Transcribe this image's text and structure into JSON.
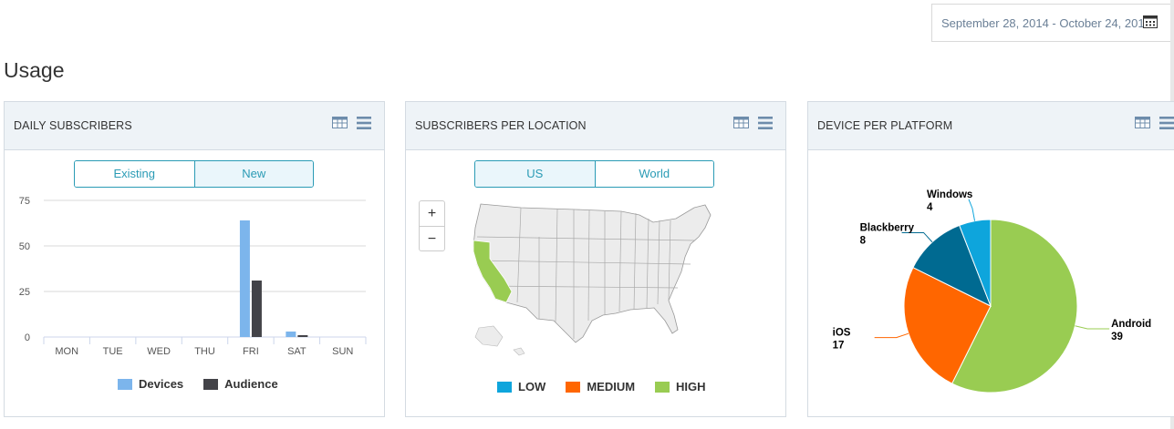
{
  "header": {
    "date_range": "September 28, 2014 - October 24, 2015",
    "calendar_icon": "calendar-icon",
    "page_title": "Usage"
  },
  "panels": {
    "daily": {
      "title": "DAILY SUBSCRIBERS",
      "tabs": [
        "Existing",
        "New"
      ],
      "active_tab": "New",
      "icons": [
        "table-icon",
        "menu-icon"
      ]
    },
    "location": {
      "title": "SUBSCRIBERS PER LOCATION",
      "tabs": [
        "US",
        "World"
      ],
      "active_tab": "US",
      "zoom_in": "+",
      "zoom_out": "−",
      "legend": [
        {
          "label": "LOW",
          "color": "#0ea5dc"
        },
        {
          "label": "MEDIUM",
          "color": "#ff6600"
        },
        {
          "label": "HIGH",
          "color": "#99cc52"
        }
      ],
      "highlighted_state": "California",
      "icons": [
        "table-icon",
        "menu-icon"
      ]
    },
    "platform": {
      "title": "DEVICE PER PLATFORM",
      "icons": [
        "table-icon",
        "menu-icon"
      ]
    }
  },
  "chart_data": [
    {
      "type": "bar",
      "categories": [
        "MON",
        "TUE",
        "WED",
        "THU",
        "FRI",
        "SAT",
        "SUN"
      ],
      "series": [
        {
          "name": "Devices",
          "color": "#7cb5ec",
          "values": [
            0,
            0,
            0,
            0,
            64,
            3,
            0
          ]
        },
        {
          "name": "Audience",
          "color": "#434348",
          "values": [
            0,
            0,
            0,
            0,
            31,
            1,
            0
          ]
        }
      ],
      "yticks": [
        0,
        25,
        50,
        75
      ],
      "ylim": [
        0,
        75
      ],
      "grid": true,
      "legend_position": "bottom"
    },
    {
      "type": "pie",
      "slices": [
        {
          "label": "Android",
          "value": 39,
          "color": "#99cc52"
        },
        {
          "label": "iOS",
          "value": 17,
          "color": "#ff6600"
        },
        {
          "label": "Blackberry",
          "value": 8,
          "color": "#006a91"
        },
        {
          "label": "Windows",
          "value": 4,
          "color": "#0ea5dc"
        }
      ]
    }
  ]
}
